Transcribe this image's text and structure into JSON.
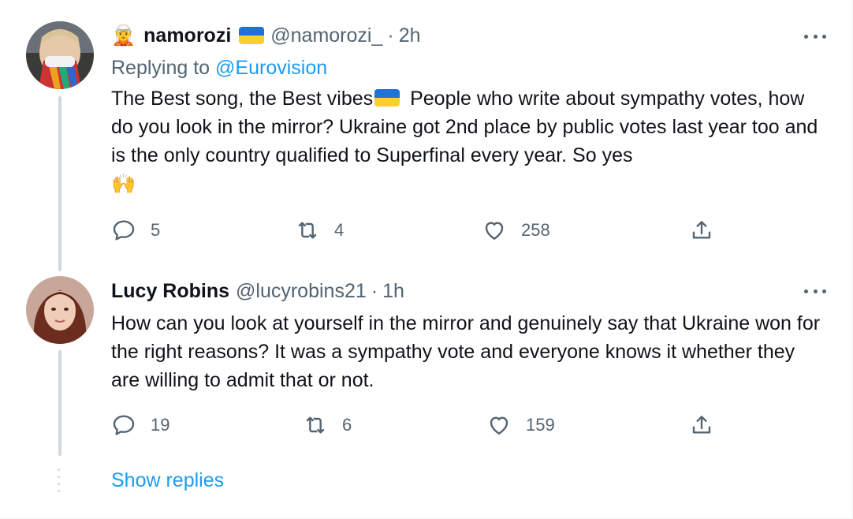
{
  "tweets": [
    {
      "badge_emoji": "🧝",
      "display_name": "namorozi",
      "has_flag_after_name": true,
      "handle": "@namorozi_",
      "separator": "·",
      "time": "2h",
      "replying_prefix": "Replying to ",
      "replying_to": "@Eurovision",
      "text_part1": "The Best song, the Best vibes",
      "text_part2": " People who write about sympathy votes, how do you look in the mirror? Ukraine got 2nd place by public votes last year too and is the only country qualified to Superfinal every year. So yes",
      "text_emoji": "🙌",
      "replies": "5",
      "retweets": "4",
      "likes": "258"
    },
    {
      "display_name": "Lucy Robins",
      "handle": "@lucyrobins21",
      "separator": "·",
      "time": "1h",
      "text": "How can you look at yourself in the mirror and genuinely say that Ukraine won for the right reasons? It was a sympathy vote and everyone knows it whether they are willing to admit that or not.",
      "replies": "19",
      "retweets": "6",
      "likes": "159"
    }
  ],
  "show_replies_label": "Show replies",
  "colors": {
    "link": "#1d9bf0",
    "secondary_text": "#536471",
    "primary_text": "#0f1419",
    "thread_line": "#cfd9de",
    "flag_blue": "#1f72d6",
    "flag_yellow": "#f8cf2c"
  },
  "icons": {
    "reply": "reply-icon",
    "retweet": "retweet-icon",
    "like": "heart-icon",
    "share": "share-icon",
    "more": "more-icon"
  }
}
